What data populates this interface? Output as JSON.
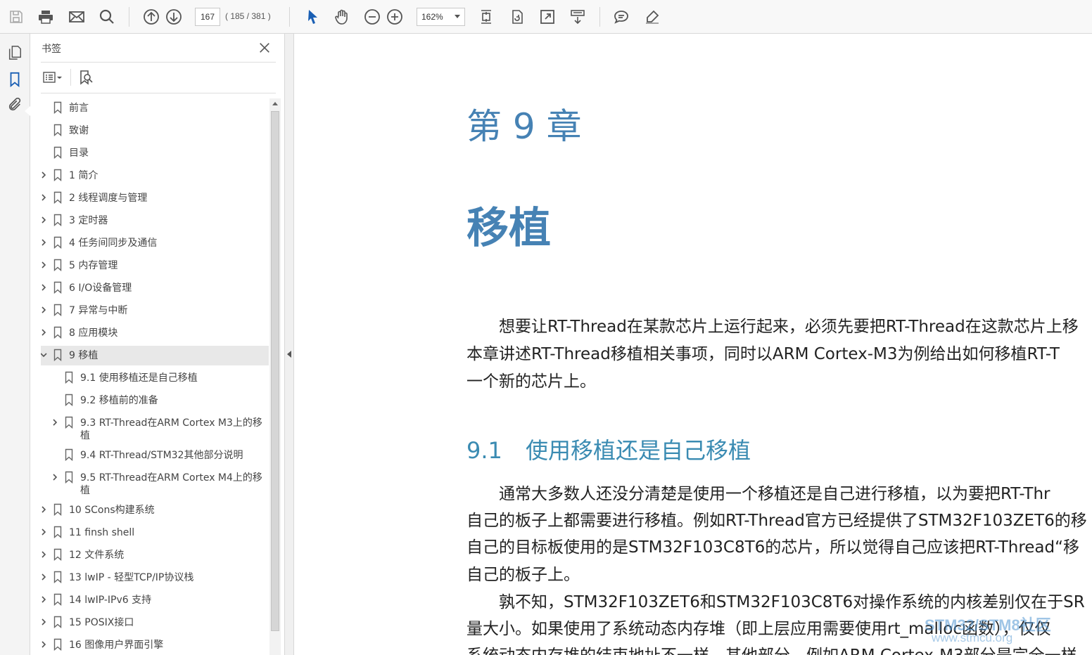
{
  "toolbar": {
    "page_current": "167",
    "page_count": "( 185 / 381 )",
    "zoom": "162%"
  },
  "panel": {
    "title": "书签"
  },
  "bookmarks": [
    {
      "label": "前言",
      "level": 0,
      "expandable": false,
      "expanded": false,
      "selected": false,
      "lines": 1
    },
    {
      "label": "致谢",
      "level": 0,
      "expandable": false,
      "expanded": false,
      "selected": false,
      "lines": 1
    },
    {
      "label": "目录",
      "level": 0,
      "expandable": false,
      "expanded": false,
      "selected": false,
      "lines": 1
    },
    {
      "label": "1 简介",
      "level": 0,
      "expandable": true,
      "expanded": false,
      "selected": false,
      "lines": 1
    },
    {
      "label": "2 线程调度与管理",
      "level": 0,
      "expandable": true,
      "expanded": false,
      "selected": false,
      "lines": 1
    },
    {
      "label": "3 定时器",
      "level": 0,
      "expandable": true,
      "expanded": false,
      "selected": false,
      "lines": 1
    },
    {
      "label": "4 任务间同步及通信",
      "level": 0,
      "expandable": true,
      "expanded": false,
      "selected": false,
      "lines": 1
    },
    {
      "label": "5 内存管理",
      "level": 0,
      "expandable": true,
      "expanded": false,
      "selected": false,
      "lines": 1
    },
    {
      "label": "6 I/O设备管理",
      "level": 0,
      "expandable": true,
      "expanded": false,
      "selected": false,
      "lines": 1
    },
    {
      "label": "7 异常与中断",
      "level": 0,
      "expandable": true,
      "expanded": false,
      "selected": false,
      "lines": 1
    },
    {
      "label": "8 应用模块",
      "level": 0,
      "expandable": true,
      "expanded": false,
      "selected": false,
      "lines": 1
    },
    {
      "label": "9 移植",
      "level": 0,
      "expandable": true,
      "expanded": true,
      "selected": true,
      "lines": 1
    },
    {
      "label": "9.1 使用移植还是自己移植",
      "level": 1,
      "expandable": false,
      "expanded": false,
      "selected": false,
      "lines": 1
    },
    {
      "label": "9.2 移植前的准备",
      "level": 1,
      "expandable": false,
      "expanded": false,
      "selected": false,
      "lines": 1
    },
    {
      "label": "9.3 RT-Thread在ARM Cortex M3上的移",
      "label2": "植",
      "level": 1,
      "expandable": true,
      "expanded": false,
      "selected": false,
      "lines": 2
    },
    {
      "label": "9.4 RT-Thread/STM32其他部分说明",
      "level": 1,
      "expandable": false,
      "expanded": false,
      "selected": false,
      "lines": 1
    },
    {
      "label": "9.5 RT-Thread在ARM Cortex M4上的移",
      "label2": "植",
      "level": 1,
      "expandable": true,
      "expanded": false,
      "selected": false,
      "lines": 2
    },
    {
      "label": "10 SCons构建系统",
      "level": 0,
      "expandable": true,
      "expanded": false,
      "selected": false,
      "lines": 1
    },
    {
      "label": "11 finsh shell",
      "level": 0,
      "expandable": true,
      "expanded": false,
      "selected": false,
      "lines": 1
    },
    {
      "label": "12 文件系统",
      "level": 0,
      "expandable": true,
      "expanded": false,
      "selected": false,
      "lines": 1
    },
    {
      "label": "13 lwIP - 轻型TCP/IP协议栈",
      "level": 0,
      "expandable": true,
      "expanded": false,
      "selected": false,
      "lines": 1
    },
    {
      "label": "14 lwIP-IPv6 支持",
      "level": 0,
      "expandable": true,
      "expanded": false,
      "selected": false,
      "lines": 1
    },
    {
      "label": "15 POSIX接口",
      "level": 0,
      "expandable": true,
      "expanded": false,
      "selected": false,
      "lines": 1
    },
    {
      "label": "16 图像用户界面引擎",
      "level": 0,
      "expandable": true,
      "expanded": false,
      "selected": false,
      "lines": 1
    }
  ],
  "document": {
    "chapter_number": "第 9 章",
    "chapter_title": "移植",
    "intro_lines": [
      "　　想要让RT-Thread在某款芯片上运行起来，必须先要把RT-Thread在这款芯片上移",
      "本章讲述RT-Thread移植相关事项，同时以ARM Cortex-M3为例给出如何移植RT-T",
      "一个新的芯片上。"
    ],
    "section_number": "9.1",
    "section_title": "使用移植还是自己移植",
    "section_lines": [
      "　　通常大多数人还没分清楚是使用一个移植还是自己进行移植，以为要把RT-Thr",
      "自己的板子上都需要进行移植。例如RT-Thread官方已经提供了STM32F103ZET6的移",
      "自己的目标板使用的是STM32F103C8T6的芯片，所以觉得自己应该把RT-Thread“移",
      "自己的板子上。",
      "　　孰不知，STM32F103ZET6和STM32F103C8T6对操作系统的内核差别仅在于SR",
      "量大小。如果使用了系统动态内存堆（即上层应用需要使用rt_malloc函数），仅仅",
      "系统动态内存堆的结束地址不一样，其他部分，例如ARM Cortex-M3部分是完全一样"
    ],
    "watermark": "STM32/STM8社区",
    "watermark_url": "www.stmcu.org"
  },
  "colors": {
    "heading_blue": "#4682b4",
    "section_blue": "#3a8bb2",
    "selected_row": "#e8e8e8",
    "select_tool_blue": "#1a5fb4"
  }
}
